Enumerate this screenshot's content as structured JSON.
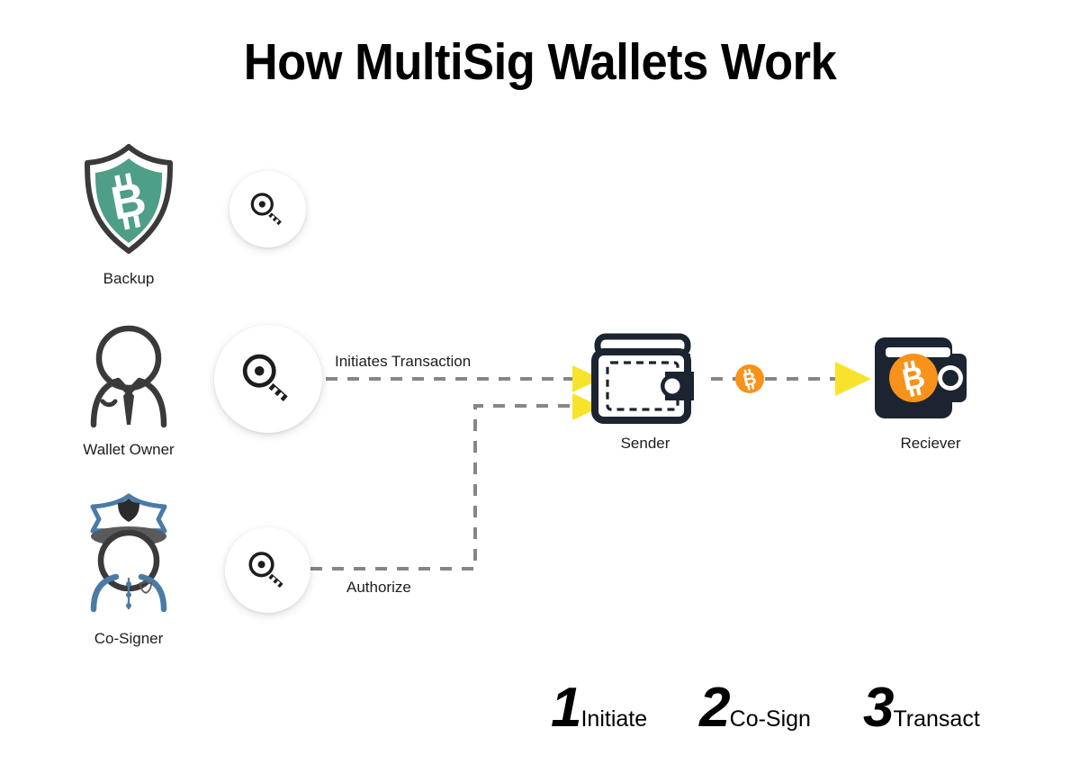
{
  "title": "How MultiSig Wallets Work",
  "colors": {
    "background": "#ffffff",
    "ink": "#1d1d1f",
    "outline": "#3a3a3a",
    "shield_green": "#4f9e87",
    "cosigner_blue": "#4a7ba7",
    "cosigner_brim": "#5a5a5a",
    "wallet_dark": "#1b2430",
    "bitcoin_orange": "#F7931A",
    "arrow_yellow": "#F7E32B",
    "dash_gray": "#868686"
  },
  "actors": [
    {
      "id": "backup",
      "label": "Backup",
      "icon": "shield-bitcoin-icon",
      "key_icon": "key-icon"
    },
    {
      "id": "wallet-owner",
      "label": "Wallet Owner",
      "icon": "person-tie-icon",
      "key_icon": "key-icon"
    },
    {
      "id": "co-signer",
      "label": "Co-Signer",
      "icon": "police-officer-icon",
      "key_icon": "key-icon"
    }
  ],
  "wallets": [
    {
      "id": "sender",
      "label": "Sender",
      "icon": "wallet-outline-icon"
    },
    {
      "id": "receiver",
      "label": "Reciever",
      "icon": "wallet-filled-bitcoin-icon"
    }
  ],
  "coin": {
    "id": "bitcoin-coin",
    "symbol": "₿",
    "icon": "bitcoin-coin-icon"
  },
  "edges": [
    {
      "id": "initiates",
      "label": "Initiates Transaction",
      "from": "wallet-owner",
      "to": "sender",
      "style": "dashed",
      "arrow": "yellow-triangle"
    },
    {
      "id": "authorize",
      "label": "Authorize",
      "from": "co-signer",
      "to": "sender",
      "style": "dashed",
      "arrow": "yellow-triangle"
    },
    {
      "id": "transfer",
      "label": "",
      "from": "sender",
      "to": "receiver",
      "style": "dashed",
      "arrow": "yellow-triangle"
    }
  ],
  "steps": [
    {
      "number": "1",
      "label": "Initiate"
    },
    {
      "number": "2",
      "label": "Co-Sign"
    },
    {
      "number": "3",
      "label": "Transact"
    }
  ]
}
